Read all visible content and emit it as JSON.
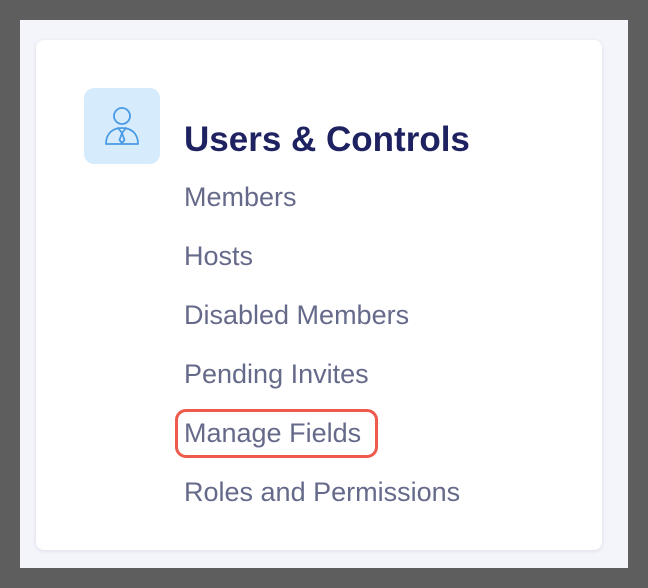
{
  "section": {
    "icon": "user-tie-icon",
    "icon_color": "#4a9be3",
    "tile_color": "#d6ecfd",
    "title": "Users & Controls"
  },
  "menu": {
    "items": [
      {
        "label": "Members"
      },
      {
        "label": "Hosts"
      },
      {
        "label": "Disabled Members"
      },
      {
        "label": "Pending Invites"
      },
      {
        "label": "Manage Fields",
        "highlighted": true
      },
      {
        "label": "Roles and Permissions"
      }
    ]
  },
  "colors": {
    "title": "#1f2261",
    "menu_text": "#666a8a",
    "highlight_border": "#ee5a4c",
    "backdrop": "#5e5e5e"
  }
}
